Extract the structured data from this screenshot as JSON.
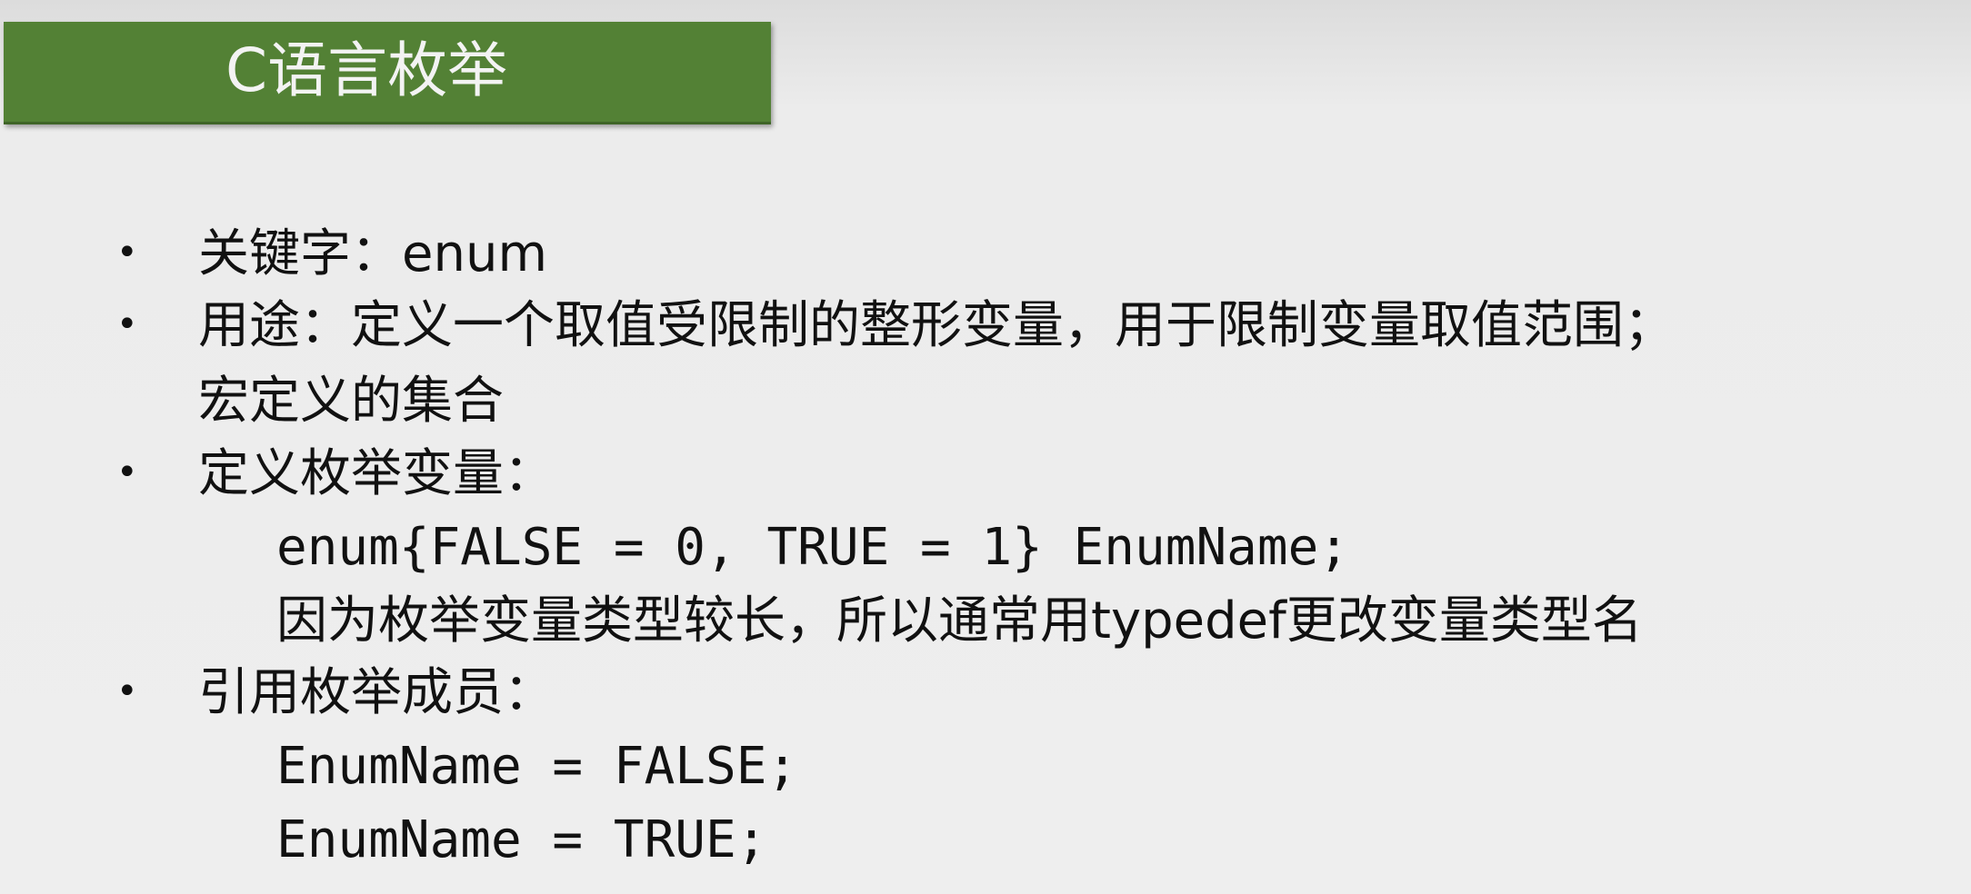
{
  "title": "C语言枚举",
  "items": [
    {
      "bullet": "•",
      "label": "关键字：enum"
    },
    {
      "bullet": "•",
      "label": "用途：定义一个取值受限制的整形变量，用于限制变量取值范围；",
      "continuation": "宏定义的集合"
    },
    {
      "bullet": "•",
      "label": "定义枚举变量：",
      "sub": [
        "enum{FALSE = 0, TRUE = 1} EnumName;",
        "因为枚举变量类型较长，所以通常用typedef更改变量类型名"
      ]
    },
    {
      "bullet": "•",
      "label": "引用枚举成员：",
      "sub": [
        "EnumName = FALSE;",
        "EnumName = TRUE;"
      ]
    }
  ],
  "colors": {
    "title_bar": "#538135",
    "title_text": "#f3f3f3",
    "background": "#eeeeee",
    "body_text": "#111111"
  }
}
